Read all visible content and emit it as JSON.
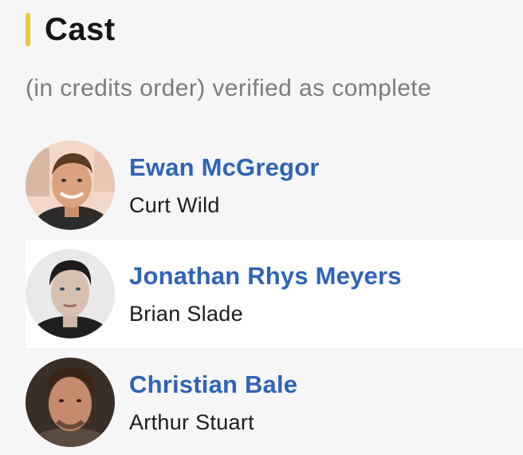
{
  "section": {
    "title": "Cast",
    "subtitle": "(in credits order) verified as complete",
    "accent_color": "#f0c43a"
  },
  "cast": [
    {
      "actor": "Ewan McGregor",
      "character": "Curt Wild",
      "avatar_icon": "actor-photo"
    },
    {
      "actor": "Jonathan Rhys Meyers",
      "character": "Brian Slade",
      "avatar_icon": "actor-photo"
    },
    {
      "actor": "Christian Bale",
      "character": "Arthur Stuart",
      "avatar_icon": "actor-photo"
    }
  ],
  "colors": {
    "link": "#2f63b6",
    "background": "#f6f6f6",
    "row_highlight": "#ffffff"
  }
}
